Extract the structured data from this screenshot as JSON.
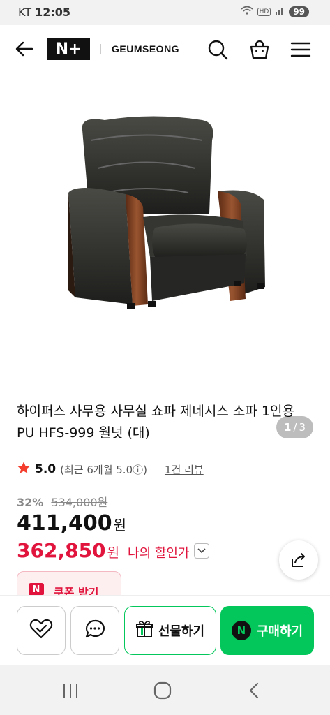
{
  "status": {
    "carrier": "KT",
    "time": "12:05",
    "battery": "99"
  },
  "header": {
    "logo_text": "N+",
    "brand": "GEUMSEONG"
  },
  "icons": {
    "back": "arrow-left-icon",
    "search": "search-icon",
    "cart": "cart-icon",
    "menu": "hamburger-menu-icon",
    "share": "share-icon",
    "wish": "heart-check-icon",
    "talk": "chat-bubble-icon",
    "gift": "gift-icon",
    "star": "star-icon"
  },
  "gallery": {
    "current": "1",
    "separator": "/",
    "total": "3"
  },
  "product": {
    "title": "하이퍼스 사무용 사무실 쇼파 제네시스 소파 1인용 PU HFS-999 월넛 (대)",
    "rating": "5.0",
    "recent_rating": "(최근 6개월 5.0ⓘ)",
    "reviews": "1건 리뷰",
    "discount_pct": "32%",
    "original_price": "534,000원",
    "price": "411,400",
    "price_unit": "원",
    "my_price": "362,850",
    "my_price_unit": "원",
    "my_price_label": "나의 할인가"
  },
  "coupon": {
    "badge": "N",
    "label": "쿠폰 받기"
  },
  "actions": {
    "gift_label": "선물하기",
    "buy_badge": "N",
    "buy_label": "구매하기"
  },
  "colors": {
    "accent_green": "#03c75a",
    "price_red": "#e0143c"
  }
}
